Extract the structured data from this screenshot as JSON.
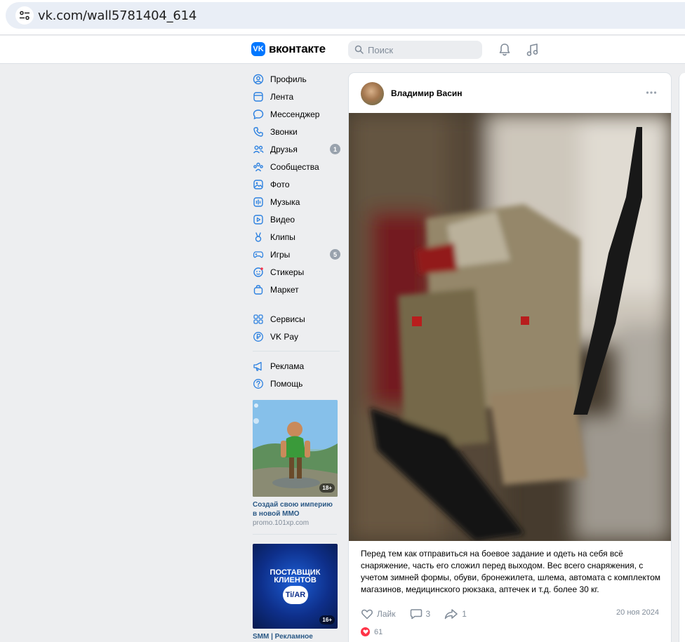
{
  "browser": {
    "url": "vk.com/wall5781404_614",
    "site_info_icon": "tune-icon"
  },
  "header": {
    "logo_mark": "VK",
    "logo_text": "вконтакте",
    "search_placeholder": "Поиск",
    "icons": [
      "bell-icon",
      "music-note-icon"
    ],
    "brand_color": "#0077ff"
  },
  "sidebar": {
    "items": [
      {
        "label": "Профиль",
        "icon": "user-circle-icon"
      },
      {
        "label": "Лента",
        "icon": "newsfeed-icon"
      },
      {
        "label": "Мессенджер",
        "icon": "message-bubble-icon"
      },
      {
        "label": "Звонки",
        "icon": "phone-icon"
      },
      {
        "label": "Друзья",
        "icon": "users-icon",
        "badge": "1"
      },
      {
        "label": "Сообщества",
        "icon": "communities-icon"
      },
      {
        "label": "Фото",
        "icon": "photo-icon"
      },
      {
        "label": "Музыка",
        "icon": "music-icon"
      },
      {
        "label": "Видео",
        "icon": "video-icon"
      },
      {
        "label": "Клипы",
        "icon": "clips-icon"
      },
      {
        "label": "Игры",
        "icon": "gamepad-icon",
        "badge": "5"
      },
      {
        "label": "Стикеры",
        "icon": "sticker-icon"
      },
      {
        "label": "Маркет",
        "icon": "market-bag-icon"
      }
    ],
    "items2": [
      {
        "label": "Сервисы",
        "icon": "services-grid-icon"
      },
      {
        "label": "VK Pay",
        "icon": "vkpay-icon"
      }
    ],
    "items3": [
      {
        "label": "Реклама",
        "icon": "megaphone-icon"
      },
      {
        "label": "Помощь",
        "icon": "help-icon"
      }
    ]
  },
  "ads": [
    {
      "title": "Создай свою империю в новой MMO",
      "domain": "promo.101xp.com",
      "age": "18+"
    },
    {
      "title": "SMM | Рекламное",
      "age": "16+",
      "image_text_1": "ПОСТАВЩИК",
      "image_text_2": "КЛИЕНТОВ",
      "image_text_3": "Ti/AR"
    }
  ],
  "post": {
    "author": "Владимир Васин",
    "text": "Перед тем как отправиться на боевое задание и одеть на себя всё снаряжение, часть его сложил перед выходом. Вес всего снаряжения, с учетом зимней формы, обуви, бронежилета, шлема, автомата с комплектом магазинов, медицинского рюкзака, аптечек и т.д. более 30 кг.",
    "like_label": "Лайк",
    "comments_count": "3",
    "shares_count": "1",
    "date": "20 ноя 2024",
    "reactions_count": "61",
    "reaction_color": "#ff3347"
  }
}
